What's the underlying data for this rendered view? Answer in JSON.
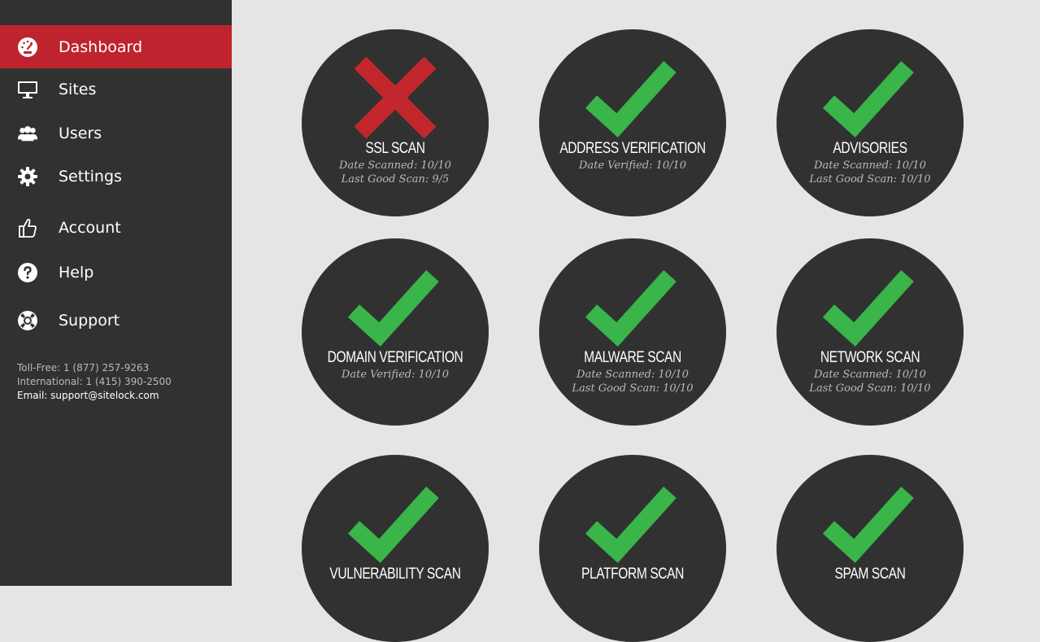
{
  "sidebar": {
    "items": [
      {
        "label": "Dashboard",
        "icon": "speedometer-icon",
        "active": true
      },
      {
        "label": "Sites",
        "icon": "monitor-icon",
        "active": false
      },
      {
        "label": "Users",
        "icon": "users-icon",
        "active": false
      },
      {
        "label": "Settings",
        "icon": "gear-icon",
        "active": false
      },
      {
        "label": "Account",
        "icon": "thumbs-up-icon",
        "active": false
      },
      {
        "label": "Help",
        "icon": "question-icon",
        "active": false
      },
      {
        "label": "Support",
        "icon": "lifebuoy-icon",
        "active": false
      }
    ],
    "contact": {
      "tollfree": "Toll-Free: 1 (877) 257-9263",
      "international": "International: 1 (415) 390-2500",
      "email": "Email: support@sitelock.com"
    }
  },
  "colors": {
    "accent": "#bf242e",
    "sidebar_bg": "#313131",
    "main_bg": "#e5e5e5",
    "pass": "#39b54a",
    "fail": "#c1272d"
  },
  "tiles": [
    {
      "title": "SSL SCAN",
      "status": "fail",
      "icon": "x-mark-icon",
      "line1": "Date Scanned: 10/10",
      "line2": "Last Good Scan: 9/5"
    },
    {
      "title": "ADDRESS VERIFICATION",
      "status": "pass",
      "icon": "check-icon",
      "line1": "Date Verified: 10/10",
      "line2": ""
    },
    {
      "title": "ADVISORIES",
      "status": "pass",
      "icon": "check-icon",
      "line1": "Date Scanned: 10/10",
      "line2": "Last Good Scan: 10/10"
    },
    {
      "title": "DOMAIN VERIFICATION",
      "status": "pass",
      "icon": "check-icon",
      "line1": "Date Verified: 10/10",
      "line2": ""
    },
    {
      "title": "MALWARE SCAN",
      "status": "pass",
      "icon": "check-icon",
      "line1": "Date Scanned: 10/10",
      "line2": "Last Good Scan: 10/10"
    },
    {
      "title": "NETWORK SCAN",
      "status": "pass",
      "icon": "check-icon",
      "line1": "Date Scanned: 10/10",
      "line2": "Last Good Scan: 10/10"
    },
    {
      "title": "VULNERABILITY SCAN",
      "status": "pass",
      "icon": "check-icon",
      "line1": "",
      "line2": ""
    },
    {
      "title": "PLATFORM SCAN",
      "status": "pass",
      "icon": "check-icon",
      "line1": "",
      "line2": ""
    },
    {
      "title": "SPAM SCAN",
      "status": "pass",
      "icon": "check-icon",
      "line1": "",
      "line2": ""
    }
  ]
}
